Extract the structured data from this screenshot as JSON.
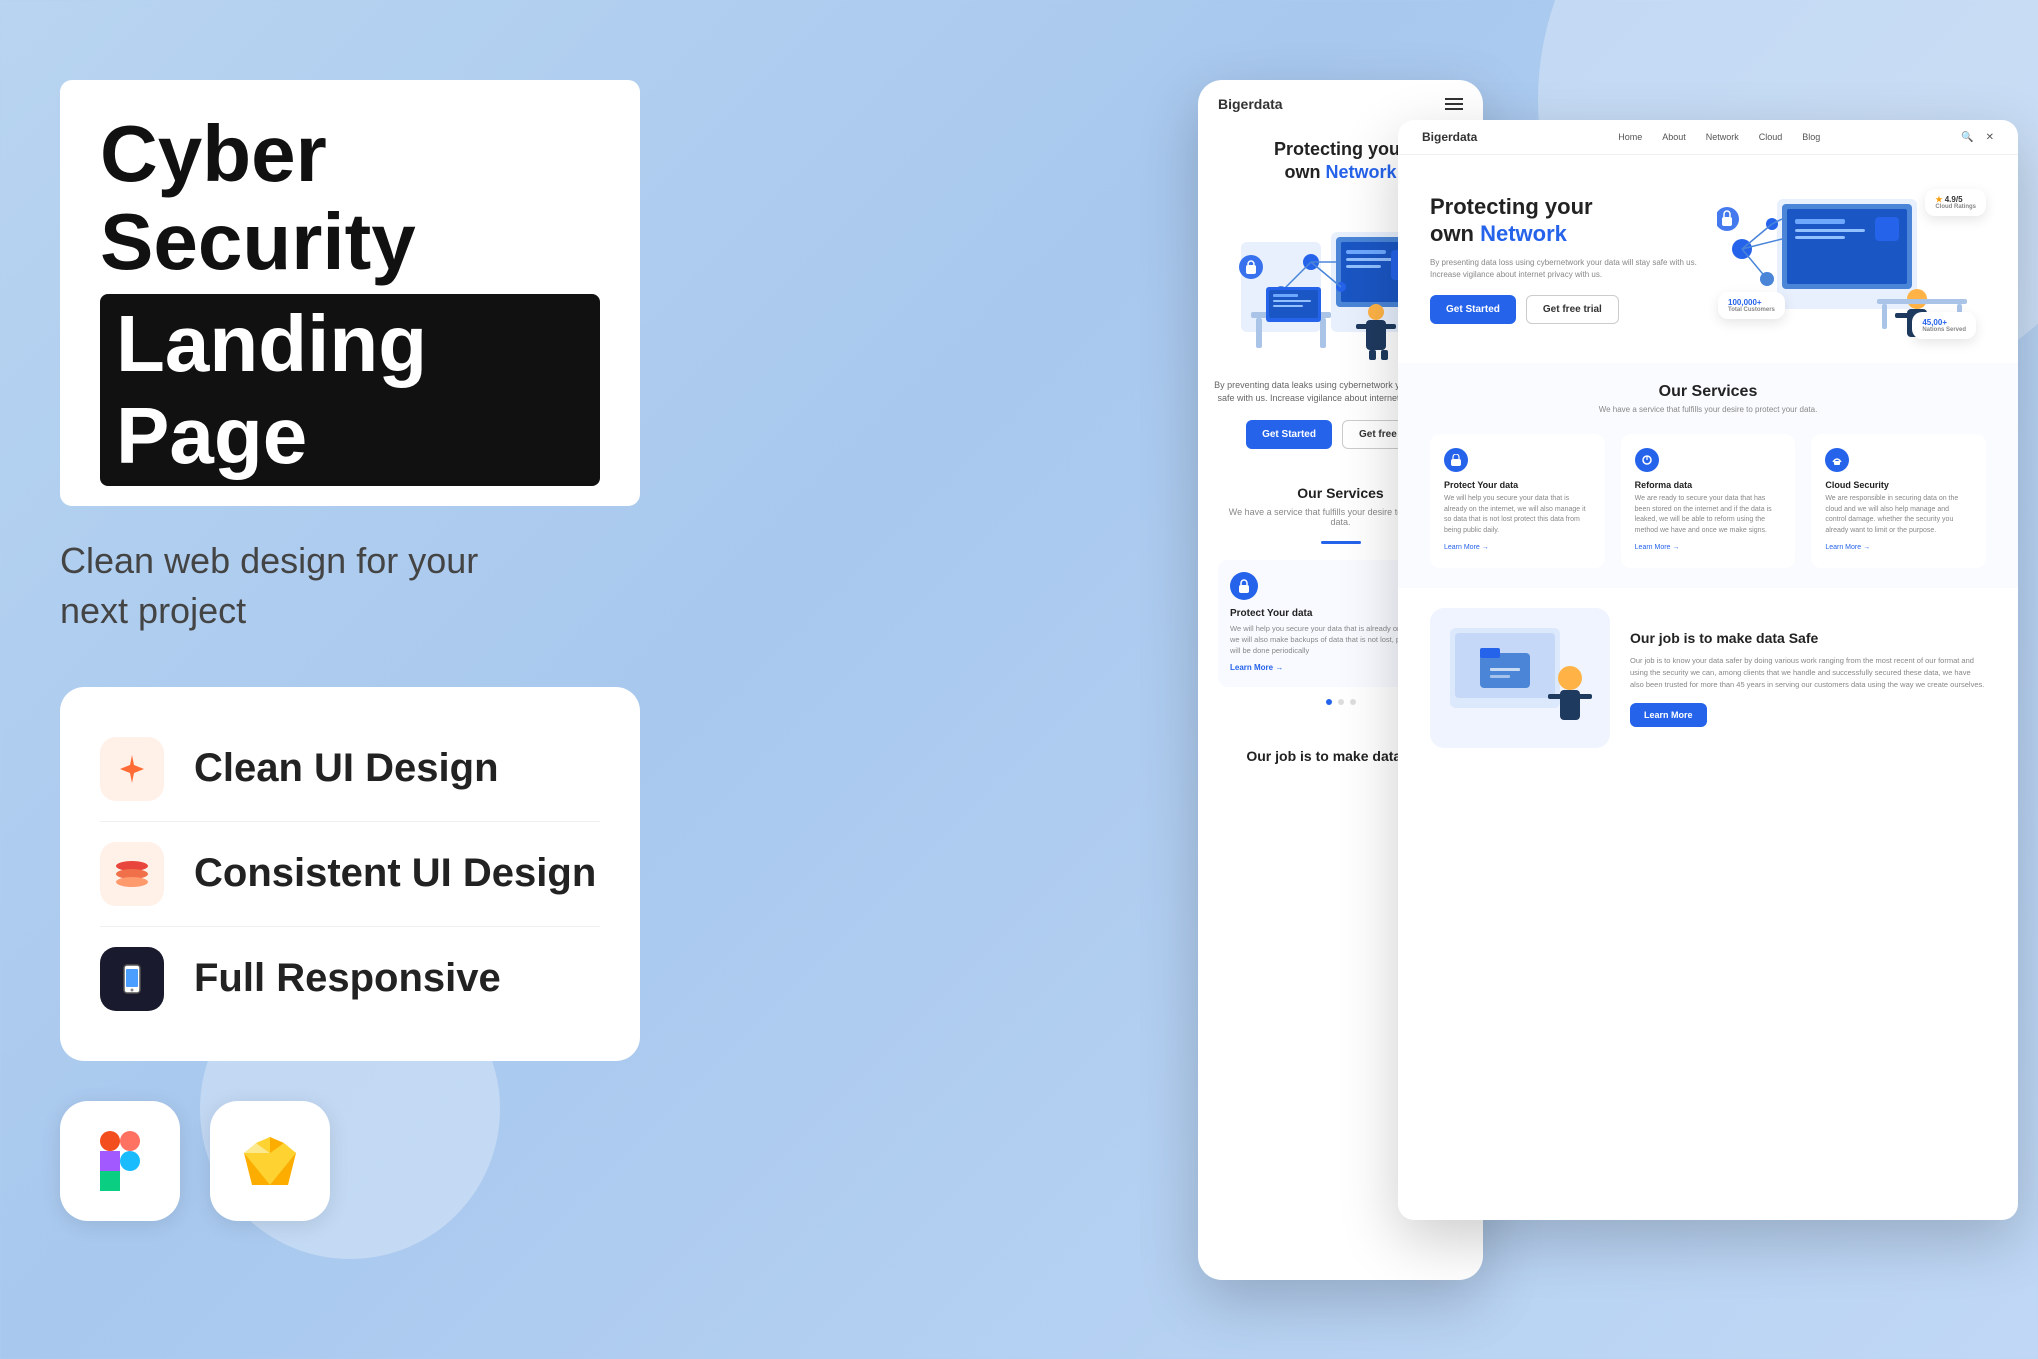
{
  "background": {
    "color": "#b8d4f0"
  },
  "left": {
    "title_line1": "Cyber Security",
    "title_line2": "Landing Page",
    "subtitle": "Clean web design for your\nnext project",
    "features": [
      {
        "id": "clean-ui",
        "label": "Clean UI Design",
        "icon": "✦",
        "icon_bg": "orange"
      },
      {
        "id": "consistent-ui",
        "label": "Consistent UI Design",
        "icon": "◈",
        "icon_bg": "red"
      },
      {
        "id": "responsive",
        "label": "Full Responsive",
        "icon": "📱",
        "icon_bg": "dark"
      }
    ],
    "tools": [
      {
        "name": "Figma",
        "icon": "figma"
      },
      {
        "name": "Sketch",
        "icon": "sketch"
      }
    ]
  },
  "mobile_mockup": {
    "brand": "Bigerdata",
    "hero_title_part1": "Protecting your",
    "hero_title_part2": "own ",
    "hero_title_highlight": "Network",
    "hero_desc": "By preventing data leaks using cybernetwork your data will stay safe with us. Increase vigilance about internet privacy with us.",
    "btn_primary": "Get Started",
    "btn_outline": "Get free trial",
    "services_title": "Our Services",
    "services_subtitle": "We have a service that fulfills your desire to protect your data.",
    "service_card": {
      "icon": "🔒",
      "title": "Protect Your data",
      "desc": "We will help you secure your data that is already on the internet, we will also make backups of data that is not lost, protect this data will be done periodically",
      "learn_more": "Learn More →"
    },
    "safe_title": "Our job is to make data Safe"
  },
  "desktop_mockup": {
    "brand": "Bigerdata",
    "nav_links": [
      "Home",
      "About",
      "Network",
      "Cloud",
      "Blog"
    ],
    "hero_title_part1": "Protecting your",
    "hero_title_part2": "own ",
    "hero_title_highlight": "Network",
    "hero_desc": "By presenting data loss using cybernetwork your data will stay safe with us. Increase vigilance about internet privacy with us.",
    "btn_primary": "Get Started",
    "btn_outline": "Get free trial",
    "stats": [
      {
        "label": "Cloud Ratings",
        "value": "4.9/5"
      },
      {
        "label": "Total Customers",
        "value": "100,000+"
      },
      {
        "label": "Nations Served",
        "value": "45,00+"
      }
    ],
    "services_title": "Our Services",
    "services_subtitle": "We have a service that fulfills your desire to protect your data.",
    "service_cards": [
      {
        "title": "Protect Your data",
        "desc": "We will help you secure your data that is already on the internet, we will also manage it so data that is not lost protect this data from being public daily."
      },
      {
        "title": "Reforma data",
        "desc": "We are ready to secure your data that has been stored on the internet and if the data is leaked, we will be able to reform using the method we have and once we make signs."
      },
      {
        "title": "Cloud Security",
        "desc": "We are responsible in securing data on the cloud and we will also help manage and control damage. whether the security you already want to limit or the purpose."
      }
    ],
    "safe_title": "Our job is to make data Safe",
    "safe_desc": "Our job is to know your data safer by doing various work ranging from the most recent of our format and using the security we can, among clients that we handle and successfully secured these data, we have also been trusted for more than 45 years in serving our customers data using the way we create ourselves.",
    "learn_more": "Learn More"
  }
}
